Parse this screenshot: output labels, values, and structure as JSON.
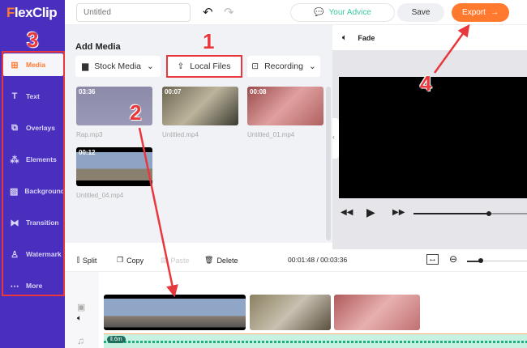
{
  "app": {
    "logo": "FlexClip",
    "accent": "#ff7a2f",
    "sidebar_color": "#4a2fbf"
  },
  "sidebar": {
    "items": [
      {
        "label": "Media",
        "icon": "folder-plus-icon",
        "active": true
      },
      {
        "label": "Text",
        "icon": "text-icon"
      },
      {
        "label": "Overlays",
        "icon": "overlays-icon"
      },
      {
        "label": "Elements",
        "icon": "elements-icon"
      },
      {
        "label": "Background",
        "icon": "background-icon"
      },
      {
        "label": "Transition",
        "icon": "transition-icon"
      },
      {
        "label": "Watermark",
        "icon": "stamp-icon"
      },
      {
        "label": "More",
        "icon": "more-icon"
      }
    ]
  },
  "topbar": {
    "title_placeholder": "Untitled",
    "advice": "Your Advice",
    "save": "Save",
    "export": "Export"
  },
  "panel": {
    "heading": "Add Media",
    "stock": "Stock Media",
    "local": "Local Files",
    "recording": "Recording",
    "media": [
      {
        "name": "Rap.mp3",
        "duration": "03:36"
      },
      {
        "name": "Untitled.mp4",
        "duration": "00:07"
      },
      {
        "name": "Untitled_01.mp4",
        "duration": "00:08"
      },
      {
        "name": "Untitled_04.mp4",
        "duration": "00:12"
      }
    ]
  },
  "preview": {
    "fade": "Fade"
  },
  "toolbar": {
    "split": "Split",
    "copy": "Copy",
    "paste": "Paste",
    "delete": "Delete",
    "time": "00:01:48 / 00:03:36"
  },
  "timeline": {
    "audio_badge": "‖.6m"
  },
  "annotations": [
    "1",
    "2",
    "3",
    "4"
  ]
}
